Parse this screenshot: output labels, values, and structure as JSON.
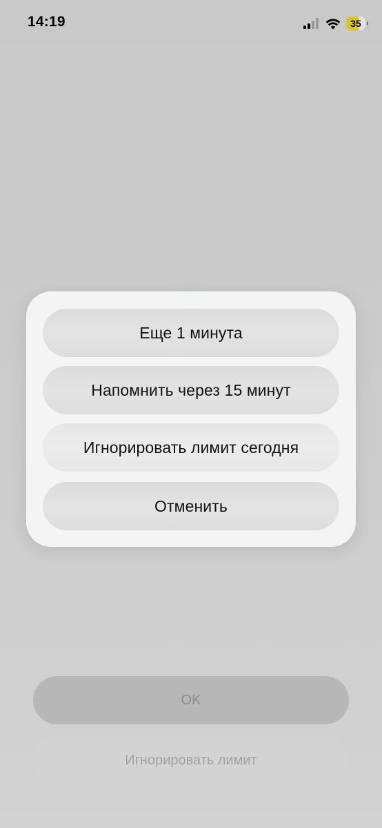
{
  "status_bar": {
    "time": "14:19",
    "battery": "35",
    "icons": [
      "signal-icon",
      "wifi-icon",
      "battery-icon"
    ]
  },
  "action_sheet": {
    "options": [
      {
        "label": "Еще 1 минута"
      },
      {
        "label": "Напомнить через 15 минут"
      },
      {
        "label": "Игнорировать лимит сегодня"
      },
      {
        "label": "Отменить"
      }
    ]
  },
  "bottom": {
    "ok_label": "OK",
    "ignore_label": "Игнорировать лимит"
  },
  "colors": {
    "background": "#c9c9c9",
    "sheet": "#f6f6f6",
    "sheet_button": "#dfdfdf",
    "battery_accent": "#d9c230"
  }
}
